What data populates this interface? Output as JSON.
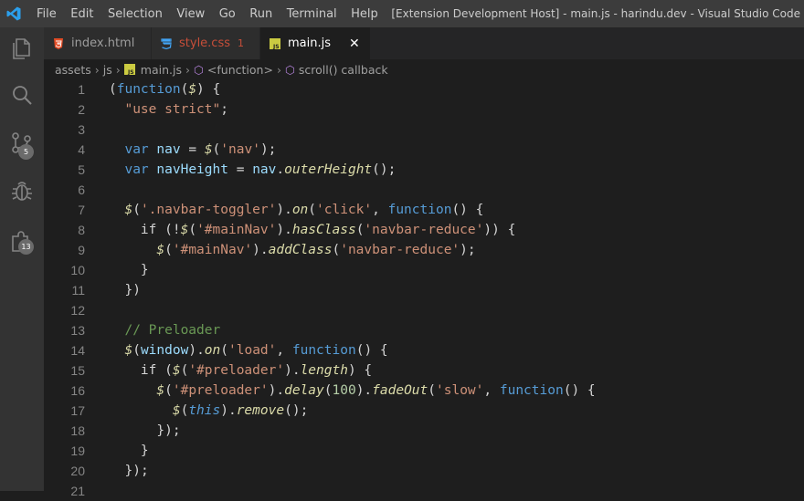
{
  "window": {
    "title": "[Extension Development Host] - main.js - harindu.dev - Visual Studio Code",
    "menu": [
      "File",
      "Edit",
      "Selection",
      "View",
      "Go",
      "Run",
      "Terminal",
      "Help"
    ]
  },
  "activity_bar": {
    "items": [
      {
        "name": "explorer-icon",
        "badge": ""
      },
      {
        "name": "search-icon",
        "badge": ""
      },
      {
        "name": "source-control-icon",
        "badge": "5"
      },
      {
        "name": "debug-icon",
        "badge": ""
      },
      {
        "name": "extensions-icon",
        "badge": "13"
      }
    ]
  },
  "tabs": [
    {
      "label": "index.html",
      "icon": "html-file-icon",
      "active": false,
      "badge": ""
    },
    {
      "label": "style.css",
      "icon": "css-file-icon",
      "active": false,
      "badge": "1"
    },
    {
      "label": "main.js",
      "icon": "js-file-icon",
      "active": true,
      "badge": ""
    }
  ],
  "breadcrumb": [
    "assets",
    "js",
    "main.js",
    "<function>",
    "scroll() callback"
  ],
  "colors": {
    "keyword": "#569cd6",
    "string": "#ce9178",
    "comment": "#6a9955",
    "function": "#dcdcaa",
    "variable": "#9cdcfe",
    "number": "#b5cea8"
  },
  "code": [
    {
      "n": "1",
      "text": "(function($) {"
    },
    {
      "n": "2",
      "text": "  \"use strict\";"
    },
    {
      "n": "3",
      "text": ""
    },
    {
      "n": "4",
      "text": "  var nav = $('nav');"
    },
    {
      "n": "5",
      "text": "  var navHeight = nav.outerHeight();"
    },
    {
      "n": "6",
      "text": ""
    },
    {
      "n": "7",
      "text": "  $('.navbar-toggler').on('click', function() {"
    },
    {
      "n": "8",
      "text": "    if (!$('#mainNav').hasClass('navbar-reduce')) {"
    },
    {
      "n": "9",
      "text": "      $('#mainNav').addClass('navbar-reduce');"
    },
    {
      "n": "10",
      "text": "    }"
    },
    {
      "n": "11",
      "text": "  })"
    },
    {
      "n": "12",
      "text": ""
    },
    {
      "n": "13",
      "text": "  // Preloader"
    },
    {
      "n": "14",
      "text": "  $(window).on('load', function() {"
    },
    {
      "n": "15",
      "text": "    if ($('#preloader').length) {"
    },
    {
      "n": "16",
      "text": "      $('#preloader').delay(100).fadeOut('slow', function() {"
    },
    {
      "n": "17",
      "text": "        $(this).remove();"
    },
    {
      "n": "18",
      "text": "      });"
    },
    {
      "n": "19",
      "text": "    }"
    },
    {
      "n": "20",
      "text": "  });"
    },
    {
      "n": "21",
      "text": ""
    }
  ]
}
